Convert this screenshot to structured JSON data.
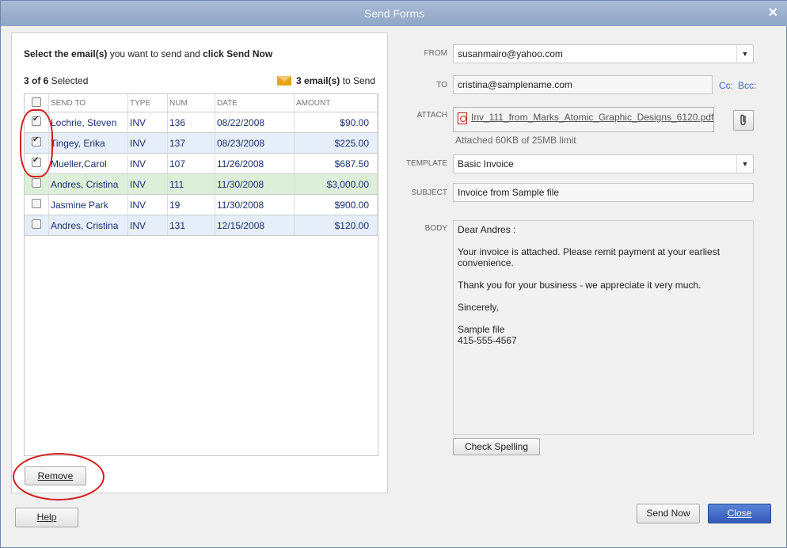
{
  "window": {
    "title": "Send Forms",
    "close": "✕"
  },
  "left": {
    "instruction": {
      "part1": "Select the email(s)",
      "part2": " you want to send and ",
      "part3": "click Send Now"
    },
    "selected": {
      "count": "3 of 6",
      "suffix": " Selected"
    },
    "send_summary": {
      "count": "3 email(s)",
      "suffix": " to Send"
    },
    "columns": {
      "send_to": "SEND TO",
      "type": "TYPE",
      "num": "NUM",
      "date": "DATE",
      "amount": "AMOUNT"
    },
    "rows": [
      {
        "checked": true,
        "send_to": "Lochrie, Steven",
        "type": "INV",
        "num": "136",
        "date": "08/22/2008",
        "amount": "$90.00"
      },
      {
        "checked": true,
        "send_to": "Tingey, Erika",
        "type": "INV",
        "num": "137",
        "date": "08/23/2008",
        "amount": "$225.00"
      },
      {
        "checked": true,
        "send_to": "Mueller,Carol",
        "type": "INV",
        "num": "107",
        "date": "11/26/2008",
        "amount": "$687.50"
      },
      {
        "checked": false,
        "send_to": "Andres, Cristina",
        "type": "INV",
        "num": "111",
        "date": "11/30/2008",
        "amount": "$3,000.00"
      },
      {
        "checked": false,
        "send_to": "Jasmine Park",
        "type": "INV",
        "num": "19",
        "date": "11/30/2008",
        "amount": "$900.00"
      },
      {
        "checked": false,
        "send_to": "Andres, Cristina",
        "type": "INV",
        "num": "131",
        "date": "12/15/2008",
        "amount": "$120.00"
      }
    ],
    "remove_button": "Remove"
  },
  "right": {
    "from_label": "FROM",
    "from_value": "susanmairo@yahoo.com",
    "to_label": "TO",
    "to_value": "cristina@samplename.com",
    "cc": "Cc:",
    "bcc": "Bcc:",
    "attach_label": "ATTACH",
    "attach_file": "Inv_111_from_Marks_Atomic_Graphic_Designs_6120.pdf",
    "attach_note": "Attached 60KB of 25MB limit",
    "template_label": "TEMPLATE",
    "template_value": "Basic Invoice",
    "subject_label": "SUBJECT",
    "subject_value": "Invoice from Sample file",
    "body_label": "BODY",
    "body_paragraphs": [
      "Dear Andres :",
      "Your invoice is attached. Please remit payment at your earliest convenience.",
      "Thank you for your business - we appreciate it very much.",
      "Sincerely,",
      "Sample file\n415-555-4567"
    ],
    "check_spelling": "Check Spelling"
  },
  "footer": {
    "help": "Help",
    "send_now": "Send Now",
    "close": "Close"
  },
  "colors": {
    "close_button": "#3a62c4",
    "annotation": "#d31d1d",
    "selected_row": "#dcefd8"
  }
}
